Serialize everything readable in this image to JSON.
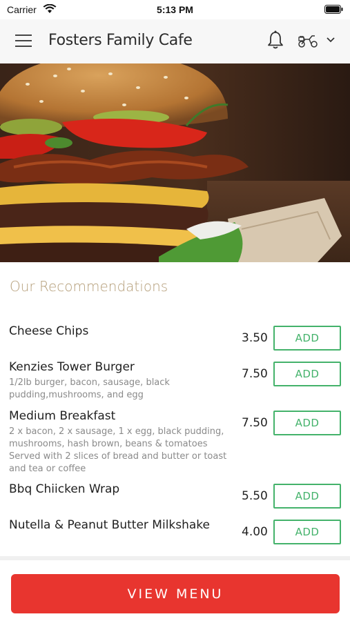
{
  "status_bar": {
    "carrier": "Carrier",
    "time": "5:13 PM"
  },
  "header": {
    "title": "Fosters Family Cafe",
    "icons": [
      "menu-icon",
      "bell-icon",
      "scooter-icon",
      "chevron-down-icon"
    ]
  },
  "hero": {
    "image": "cheeseburger-with-bacon"
  },
  "recommendations": {
    "title": "Our Recommendations",
    "items": [
      {
        "name": "Cheese Chips",
        "description": "",
        "price": "3.50",
        "button": "ADD"
      },
      {
        "name": "Kenzies Tower Burger",
        "description": "1/2lb burger, bacon, sausage, black pudding,mushrooms, and egg",
        "price": "7.50",
        "button": "ADD"
      },
      {
        "name": "Medium Breakfast",
        "description": "2 x bacon, 2 x sausage, 1 x egg, black pudding, mushrooms, hash brown, beans & tomatoes Served with 2 slices of bread and butter or toast and tea or coffee",
        "price": "7.50",
        "button": "ADD"
      },
      {
        "name": "Bbq Chiicken Wrap",
        "description": "",
        "price": "5.50",
        "button": "ADD"
      },
      {
        "name": "Nutella & Peanut Butter Milkshake",
        "description": "",
        "price": "4.00",
        "button": "ADD"
      }
    ]
  },
  "footer": {
    "view_menu_label": "VIEW MENU"
  },
  "colors": {
    "accent_red": "#e8352f",
    "add_green": "#43b26a",
    "section_gold": "#b49d78"
  }
}
